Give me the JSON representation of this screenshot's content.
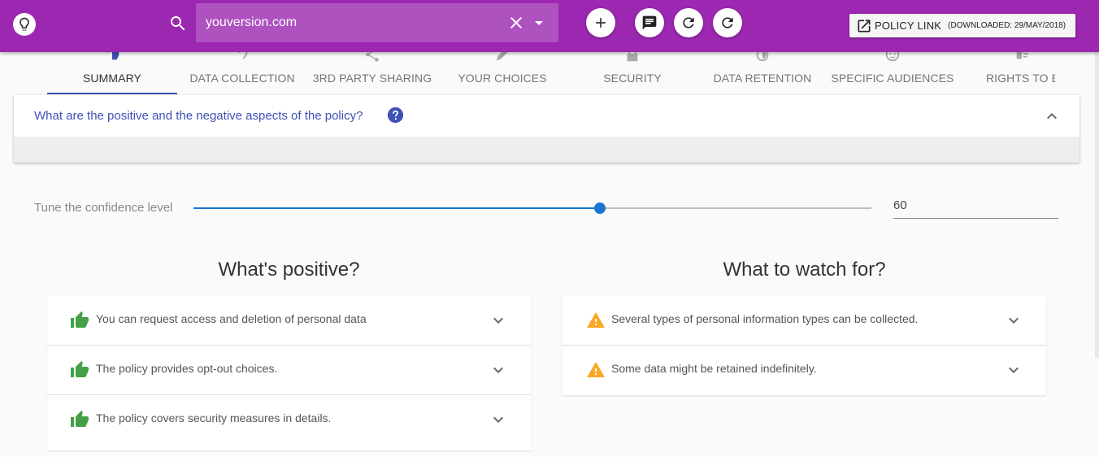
{
  "search": {
    "value": "youversion.com"
  },
  "policy_link": {
    "label": "POLICY LINK",
    "downloaded": "(DOWNLOADED: 29/MAY/2018)"
  },
  "tabs": [
    {
      "label": "SUMMARY",
      "icon": "thumbs-icon"
    },
    {
      "label": "DATA COLLECTION",
      "icon": "ear-icon"
    },
    {
      "label": "3RD PARTY SHARING",
      "icon": "share-icon"
    },
    {
      "label": "YOUR CHOICES",
      "icon": "pencil-icon"
    },
    {
      "label": "SECURITY",
      "icon": "lock-icon"
    },
    {
      "label": "DATA RETENTION",
      "icon": "timer-icon"
    },
    {
      "label": "SPECIFIC AUDIENCES",
      "icon": "face-icon"
    },
    {
      "label": "RIGHTS TO E",
      "icon": "list-icon"
    }
  ],
  "panel": {
    "question": "What are the positive and the negative aspects of the policy?"
  },
  "confidence": {
    "label": "Tune the confidence level",
    "value": 60,
    "min": 0,
    "max": 100,
    "display": "60"
  },
  "positive": {
    "title": "What's positive?",
    "items": [
      "You can request access and deletion of personal data",
      "The policy provides opt-out choices.",
      "The policy covers security measures in details."
    ]
  },
  "watch": {
    "title": "What to watch for?",
    "items": [
      "Several types of personal information types can be collected.",
      "Some data might be retained indefinitely."
    ]
  },
  "colors": {
    "appbar": "#9c27b0",
    "accent": "#3f51b5",
    "slider": "#1976d2",
    "positive": "#43a047",
    "warning": "#f9a825"
  }
}
